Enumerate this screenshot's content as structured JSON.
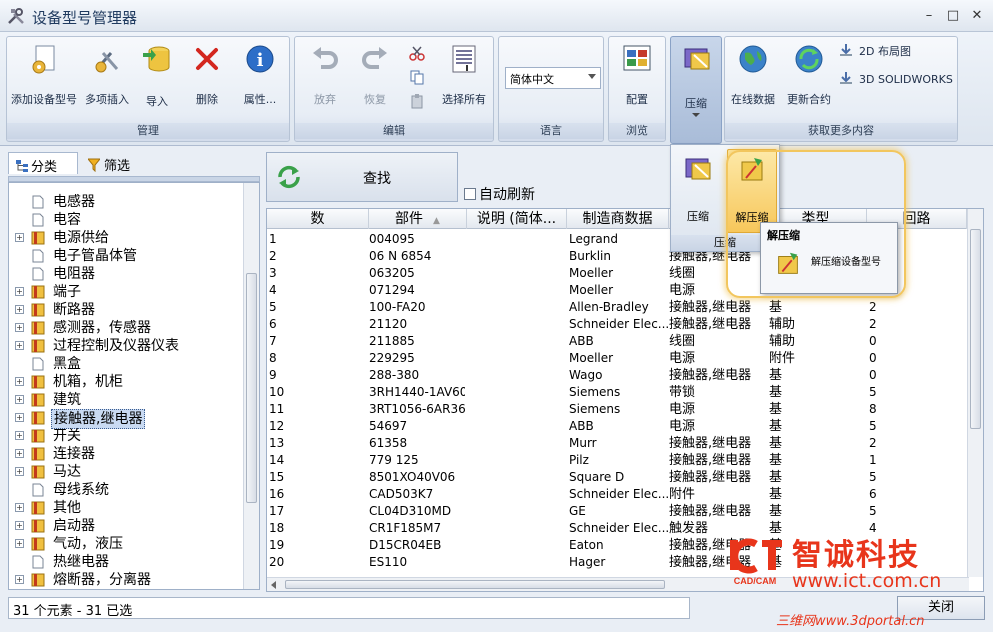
{
  "window": {
    "title": "设备型号管理器",
    "minimize": "–",
    "restore": "□",
    "close": "✕"
  },
  "ribbon": {
    "groups": {
      "manage": "管理",
      "edit": "编辑",
      "language": "语言",
      "browse": "浏览",
      "get_more": "获取更多内容"
    },
    "buttons": {
      "add_device": "添加设备型号",
      "multi_insert": "多项插入",
      "import": "导入",
      "delete": "删除",
      "properties": "属性...",
      "discard": "放弃",
      "restore": "恢复",
      "select_all": "选择所有",
      "config": "配置",
      "compress": "压缩",
      "online_data": "在线数据",
      "update_contract": "更新合约",
      "layout_2d": "2D 布局图",
      "solidworks_3d": "3D SOLIDWORKS"
    },
    "language_value": "简体中文"
  },
  "compress_popup": {
    "compress": "压缩",
    "decompress": "解压缩",
    "group_label": "压缩",
    "tip_title": "解压缩",
    "tip_item": "解压缩设备型号"
  },
  "left_panel": {
    "tab_category": "分类",
    "tab_filter": "筛选",
    "tree": [
      {
        "label": "电感器",
        "expandable": false
      },
      {
        "label": "电容",
        "expandable": false
      },
      {
        "label": "电源供给",
        "expandable": true
      },
      {
        "label": "电子管晶体管",
        "expandable": false
      },
      {
        "label": "电阻器",
        "expandable": false
      },
      {
        "label": "端子",
        "expandable": true
      },
      {
        "label": "断路器",
        "expandable": true
      },
      {
        "label": "感测器，传感器",
        "expandable": true
      },
      {
        "label": "过程控制及仪器仪表",
        "expandable": true
      },
      {
        "label": "黑盒",
        "expandable": false
      },
      {
        "label": "机箱，机柜",
        "expandable": true
      },
      {
        "label": "建筑",
        "expandable": true
      },
      {
        "label": "接触器,继电器",
        "expandable": true,
        "selected": true
      },
      {
        "label": "开关",
        "expandable": true
      },
      {
        "label": "连接器",
        "expandable": true
      },
      {
        "label": "马达",
        "expandable": true
      },
      {
        "label": "母线系统",
        "expandable": false
      },
      {
        "label": "其他",
        "expandable": true
      },
      {
        "label": "启动器",
        "expandable": true
      },
      {
        "label": "气动，液压",
        "expandable": true
      },
      {
        "label": "热继电器",
        "expandable": false
      },
      {
        "label": "熔断器，分离器",
        "expandable": true
      }
    ]
  },
  "search": {
    "button": "查找",
    "auto_refresh": "自动刷新"
  },
  "grid": {
    "columns": [
      "数",
      "部件",
      "说明 (简体...",
      "制造商数据",
      "类型",
      "回路"
    ],
    "rows": [
      [
        "1",
        "004095",
        "",
        "Legrand",
        "",
        "",
        ""
      ],
      [
        "2",
        "06 N 6854",
        "",
        "Burklin",
        "接触器,继电器",
        "",
        ""
      ],
      [
        "3",
        "063205",
        "",
        "Moeller",
        "线圈",
        "",
        ""
      ],
      [
        "4",
        "071294",
        "",
        "Moeller",
        "电源",
        "",
        ""
      ],
      [
        "5",
        "100-FA20",
        "",
        "Allen-Bradley",
        "接触器,继电器",
        "基",
        "2"
      ],
      [
        "6",
        "21120",
        "",
        "Schneider Elec...",
        "接触器,继电器",
        "辅助",
        "2"
      ],
      [
        "7",
        "211885",
        "",
        "ABB",
        "线圈",
        "辅助",
        "0"
      ],
      [
        "8",
        "229295",
        "",
        "Moeller",
        "电源",
        "附件",
        "0"
      ],
      [
        "9",
        "288-380",
        "",
        "Wago",
        "接触器,继电器",
        "基",
        "0"
      ],
      [
        "10",
        "3RH1440-1AV60",
        "",
        "Siemens",
        "带锁",
        "基",
        "5"
      ],
      [
        "11",
        "3RT1056-6AR36",
        "",
        "Siemens",
        "电源",
        "基",
        "8"
      ],
      [
        "12",
        "54697",
        "",
        "ABB",
        "电源",
        "基",
        "5"
      ],
      [
        "13",
        "61358",
        "",
        "Murr",
        "接触器,继电器",
        "基",
        "2"
      ],
      [
        "14",
        "779 125",
        "",
        "Pilz",
        "接触器,继电器",
        "基",
        "1"
      ],
      [
        "15",
        "8501XO40V06",
        "",
        "Square D",
        "接触器,继电器",
        "基",
        "5"
      ],
      [
        "16",
        "CAD503K7",
        "",
        "Schneider Elec...",
        "附件",
        "基",
        "6"
      ],
      [
        "17",
        "CL04D310MD",
        "",
        "GE",
        "接触器,继电器",
        "基",
        "5"
      ],
      [
        "18",
        "CR1F185M7",
        "",
        "Schneider Elec...",
        "触发器",
        "基",
        "4"
      ],
      [
        "19",
        "D15CR04EB",
        "",
        "Eaton",
        "接触器,继电器",
        "基",
        ""
      ],
      [
        "20",
        "ES110",
        "",
        "Hager",
        "接触器,继电器",
        "基",
        ""
      ]
    ]
  },
  "status": {
    "text": "31 个元素 - 31 已选",
    "close_button": "关闭"
  },
  "watermark": {
    "brand": "智诚科技",
    "url": "www.ict.com.cn",
    "logo_text": "CAD/CAM",
    "url2": "三维网www.3dportal.cn"
  }
}
